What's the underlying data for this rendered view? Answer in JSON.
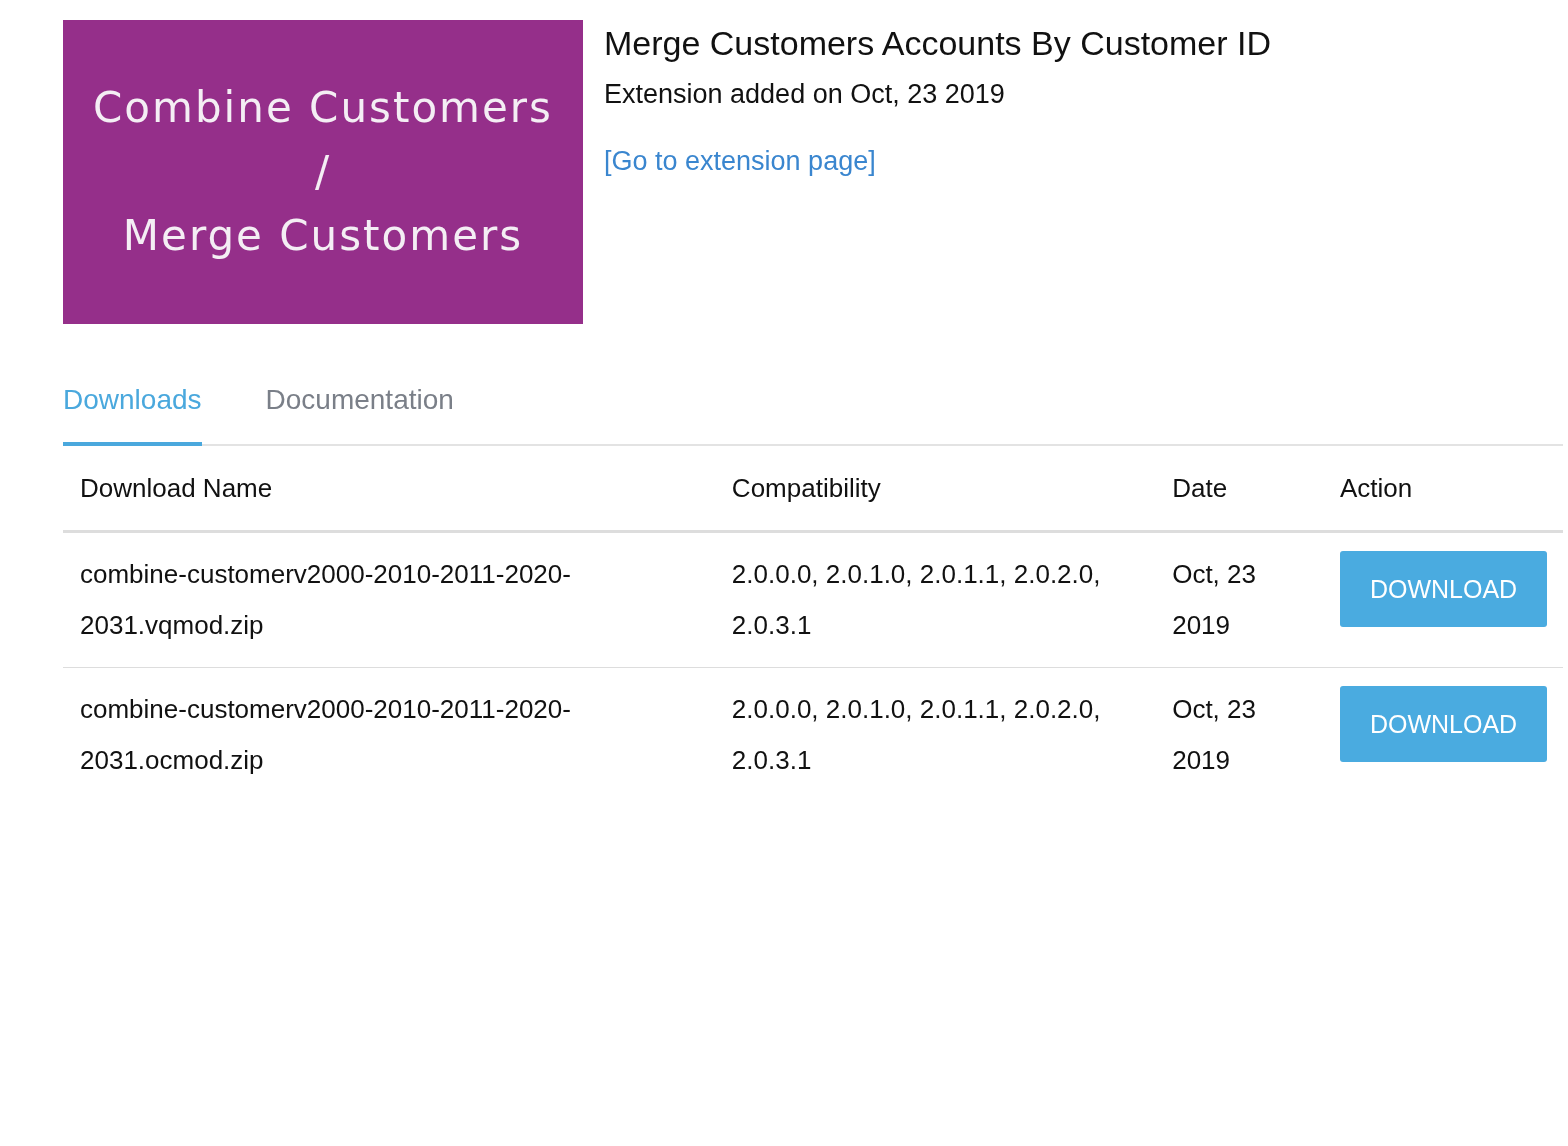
{
  "banner": {
    "lines": [
      "Combine Customers",
      "/",
      "Merge Customers"
    ]
  },
  "title": "Merge Customers Accounts By Customer ID",
  "added": "Extension added on Oct, 23 2019",
  "link": "[Go to extension page]",
  "tabs": [
    {
      "label": "Downloads",
      "selected": true
    },
    {
      "label": "Documentation",
      "selected": false
    }
  ],
  "table": {
    "columns": [
      "Download Name",
      "Compatibility",
      "Date",
      "Action"
    ],
    "rows": [
      {
        "name": "combine-customerv2000-2010-2011-2020-2031.vqmod.zip",
        "compatibility": "2.0.0.0, 2.0.1.0, 2.0.1.1, 2.0.2.0, 2.0.3.1",
        "date": "Oct, 23 2019",
        "action": "DOWNLOAD"
      },
      {
        "name": "combine-customerv2000-2010-2011-2020-2031.ocmod.zip",
        "compatibility": "2.0.0.0, 2.0.1.0, 2.0.1.1, 2.0.2.0, 2.0.3.1",
        "date": "Oct, 23 2019",
        "action": "DOWNLOAD"
      }
    ]
  }
}
